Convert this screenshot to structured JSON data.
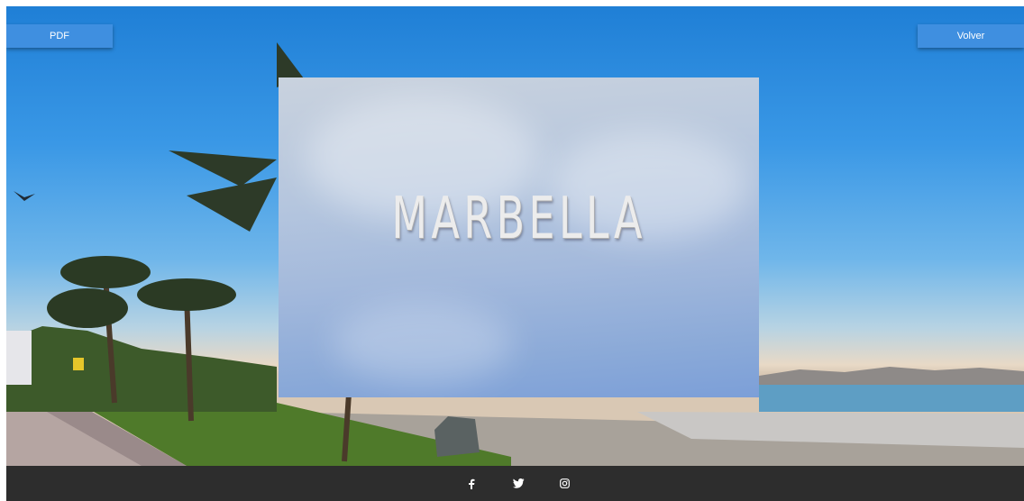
{
  "header": {
    "pdf_label": "PDF",
    "volver_label": "Volver"
  },
  "hero": {
    "title": "MARBELLA"
  },
  "footer": {
    "social": [
      "facebook-icon",
      "twitter-icon",
      "instagram-icon"
    ]
  },
  "colors": {
    "button_bg": "#3f8fe0",
    "footer_bg": "#2d2d2d"
  }
}
